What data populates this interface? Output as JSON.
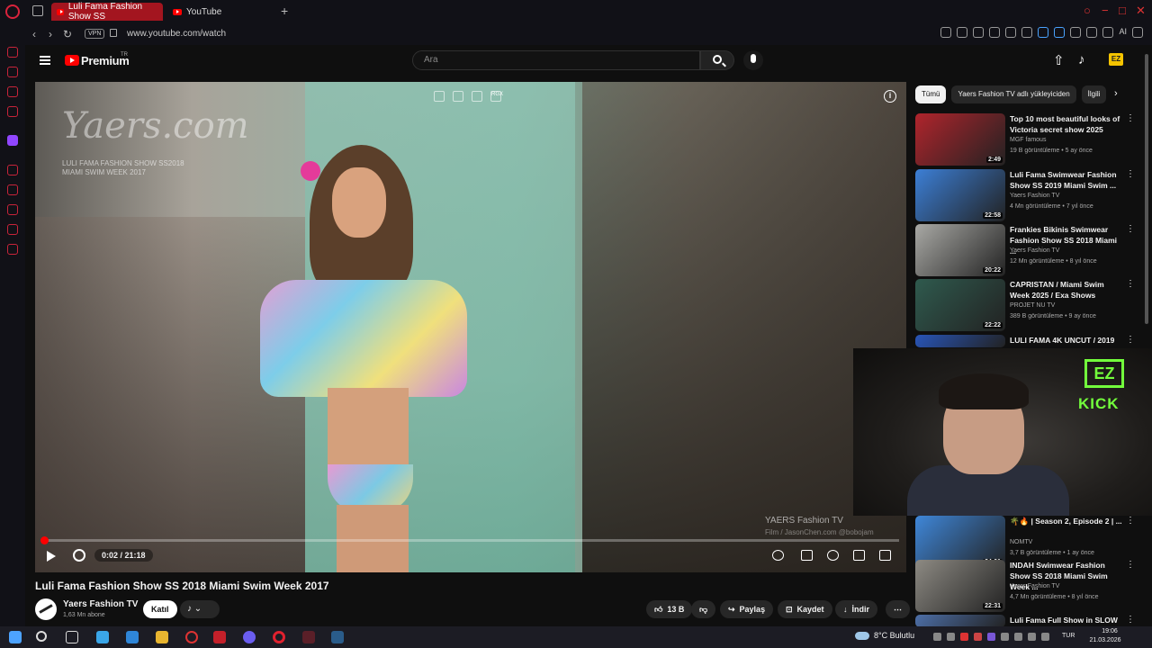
{
  "browser": {
    "tabs": [
      {
        "label": "Luli Fama Fashion Show SS",
        "active": true
      },
      {
        "label": "YouTube",
        "active": false
      }
    ],
    "vpn_label": "VPN",
    "url": "www.youtube.com/watch",
    "ai_label": "AI"
  },
  "header": {
    "brand": "Premium",
    "region": "TR",
    "search_placeholder": "Ara",
    "ez_badge": "EZ"
  },
  "player": {
    "watermark": "Yaers.com",
    "watermark_sub1": "LULI FAMA FASHION SHOW SS2018",
    "watermark_sub2": "MIAMI SWIM WEEK 2017",
    "mini_controls": [
      "",
      "",
      "",
      "RGX"
    ],
    "credits": "YAERS Fashion TV",
    "credits_sub": "Film / JasonChen.com @bobojam",
    "time": "0:02 / 21:18",
    "progress": 0.0016
  },
  "video": {
    "title": "Luli Fama Fashion Show SS 2018 Miami Swim Week 2017",
    "channel": "Yaers Fashion TV",
    "subscribers": "1,63 Mn abone",
    "join_label": "Katıl",
    "likes": "13 B",
    "share_label": "Paylaş",
    "save_label": "Kaydet",
    "download_label": "İndir"
  },
  "chips": [
    "Tümü",
    "Yaers Fashion TV adlı yükleyiciden",
    "İlgili"
  ],
  "recommendations": [
    {
      "title": "Top 10 most beautiful looks of Victoria secret show 2025",
      "channel": "MGF famous",
      "meta": "19 B görüntüleme • 5 ay önce",
      "duration": "2:49",
      "color": "#b0242c"
    },
    {
      "title": "Luli Fama Swimwear Fashion Show SS 2019 Miami Swim ...",
      "channel": "Yaers Fashion TV",
      "meta": "4 Mn görüntüleme • 7 yıl önce",
      "duration": "22:58",
      "color": "#3c7fd6"
    },
    {
      "title": "Frankies Bikinis Swimwear Fashion Show SS 2018 Miami ...",
      "channel": "Yaers Fashion TV",
      "meta": "12 Mn görüntüleme • 8 yıl önce",
      "duration": "20:22",
      "color": "#a9a9a5"
    },
    {
      "title": "CAPRISTAN / Miami Swim Week 2025 / Exa Shows",
      "channel": "PROJET NU TV",
      "meta": "389 B görüntüleme • 9 ay önce",
      "duration": "22:22",
      "color": "#2f5a4e"
    },
    {
      "title": "LULI FAMA 4K UNCUT / 2019",
      "channel": "",
      "meta": "",
      "duration": "",
      "color": "#2855b8"
    },
    {
      "title": "🌴🔥 | Season 2, Episode 2 | ...",
      "channel": "NOMTV",
      "meta": "3,7 B görüntüleme • 1 ay önce",
      "duration": "24:01",
      "color": "#3f87d9"
    },
    {
      "title": "INDAH Swimwear Fashion Show SS 2018 Miami Swim Week ...",
      "channel": "Yaers Fashion TV",
      "meta": "4,7 Mn görüntüleme • 8 yıl önce",
      "duration": "22:31",
      "color": "#8d8a83"
    },
    {
      "title": "Luli Fama Full Show in SLOW",
      "channel": "",
      "meta": "",
      "duration": "",
      "color": "#4d6fa8"
    }
  ],
  "webcam": {
    "badge": "EZ",
    "platform": "KICK"
  },
  "taskbar": {
    "weather": "8°C  Bulutlu",
    "lang": "TUR",
    "time": "19:06",
    "date": "21.03.2026"
  }
}
